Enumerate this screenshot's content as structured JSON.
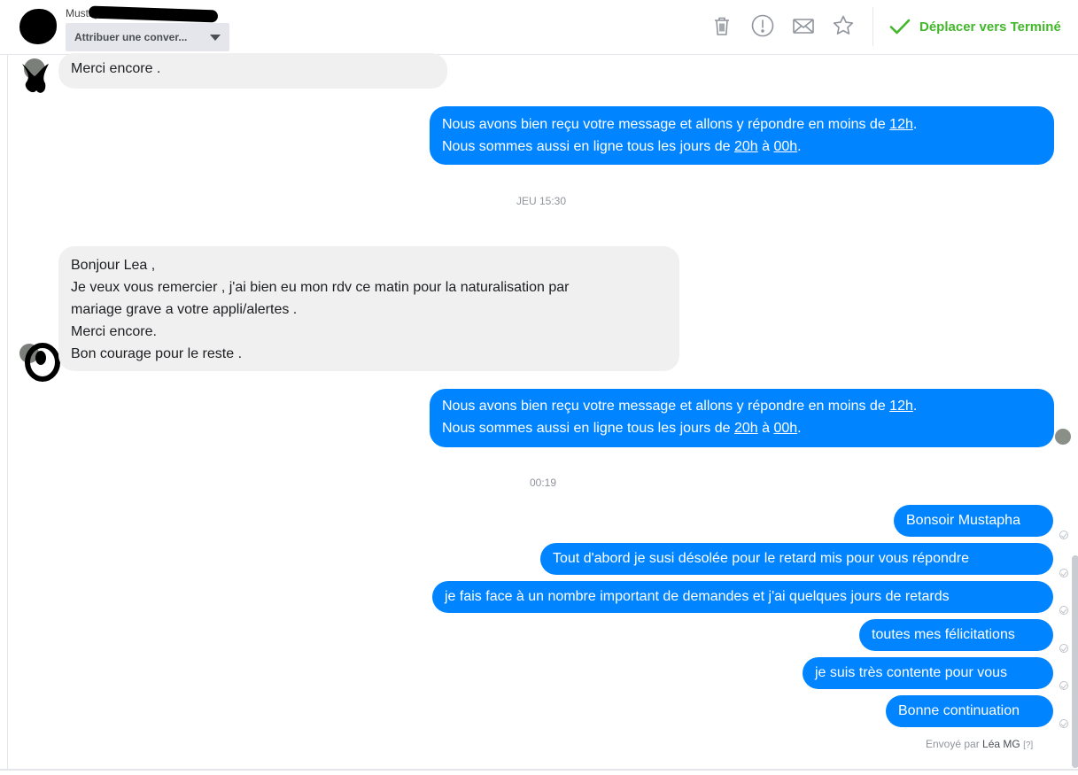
{
  "header": {
    "contact_name": "Mustapha Le Rabat",
    "assign_label": "Attribuer une conver...",
    "move_done_label": "Déplacer vers Terminé",
    "icons": [
      "trash-icon",
      "exclamation-icon",
      "envelope-icon",
      "star-icon",
      "checkmark-icon",
      "caret-down-icon"
    ],
    "accent_green": "#42b72a"
  },
  "colors": {
    "outgoing_bubble": "#0084ff",
    "incoming_bubble": "#f1f0f0"
  },
  "messages": {
    "m1": {
      "text": "Merci encore ."
    },
    "m2": {
      "line1_pre": "Nous avons bien reçu votre message et allons y répondre en moins de ",
      "line1_link": "12h",
      "line1_post": ".",
      "line2_pre": "Nous sommes aussi en ligne tous les jours de ",
      "line2_link1": "20h",
      "line2_mid": " à ",
      "line2_link2": "00h",
      "line2_post": "."
    },
    "ts1": "JEU 15:30",
    "m3": {
      "l1": "Bonjour Lea ,",
      "l2": "Je veux vous remercier , j'ai bien eu mon rdv ce matin pour la naturalisation par",
      "l3": "mariage grave a votre appli/alertes .",
      "l4": "Merci encore.",
      "l5": "Bon courage pour le reste ."
    },
    "m4": {
      "line1_pre": "Nous avons bien reçu votre message et allons y répondre en moins de ",
      "line1_link": "12h",
      "line1_post": ".",
      "line2_pre": "Nous sommes aussi en ligne tous les jours de ",
      "line2_link1": "20h",
      "line2_mid": " à ",
      "line2_link2": "00h",
      "line2_post": "."
    },
    "ts2": "00:19",
    "m5": "Bonsoir Mustapha",
    "m6": "Tout d'abord je susi désolée pour le retard mis pour vous répondre",
    "m7": "je fais face à un nombre important de demandes  et j'ai quelques jours de retards",
    "m8": "toutes mes félicitations",
    "m9": "je suis très contente pour vous",
    "m10": "Bonne continuation"
  },
  "footer": {
    "sent_by_prefix": "Envoyé par ",
    "sent_by_name": "Léa MG",
    "sent_by_help": "[?]"
  }
}
